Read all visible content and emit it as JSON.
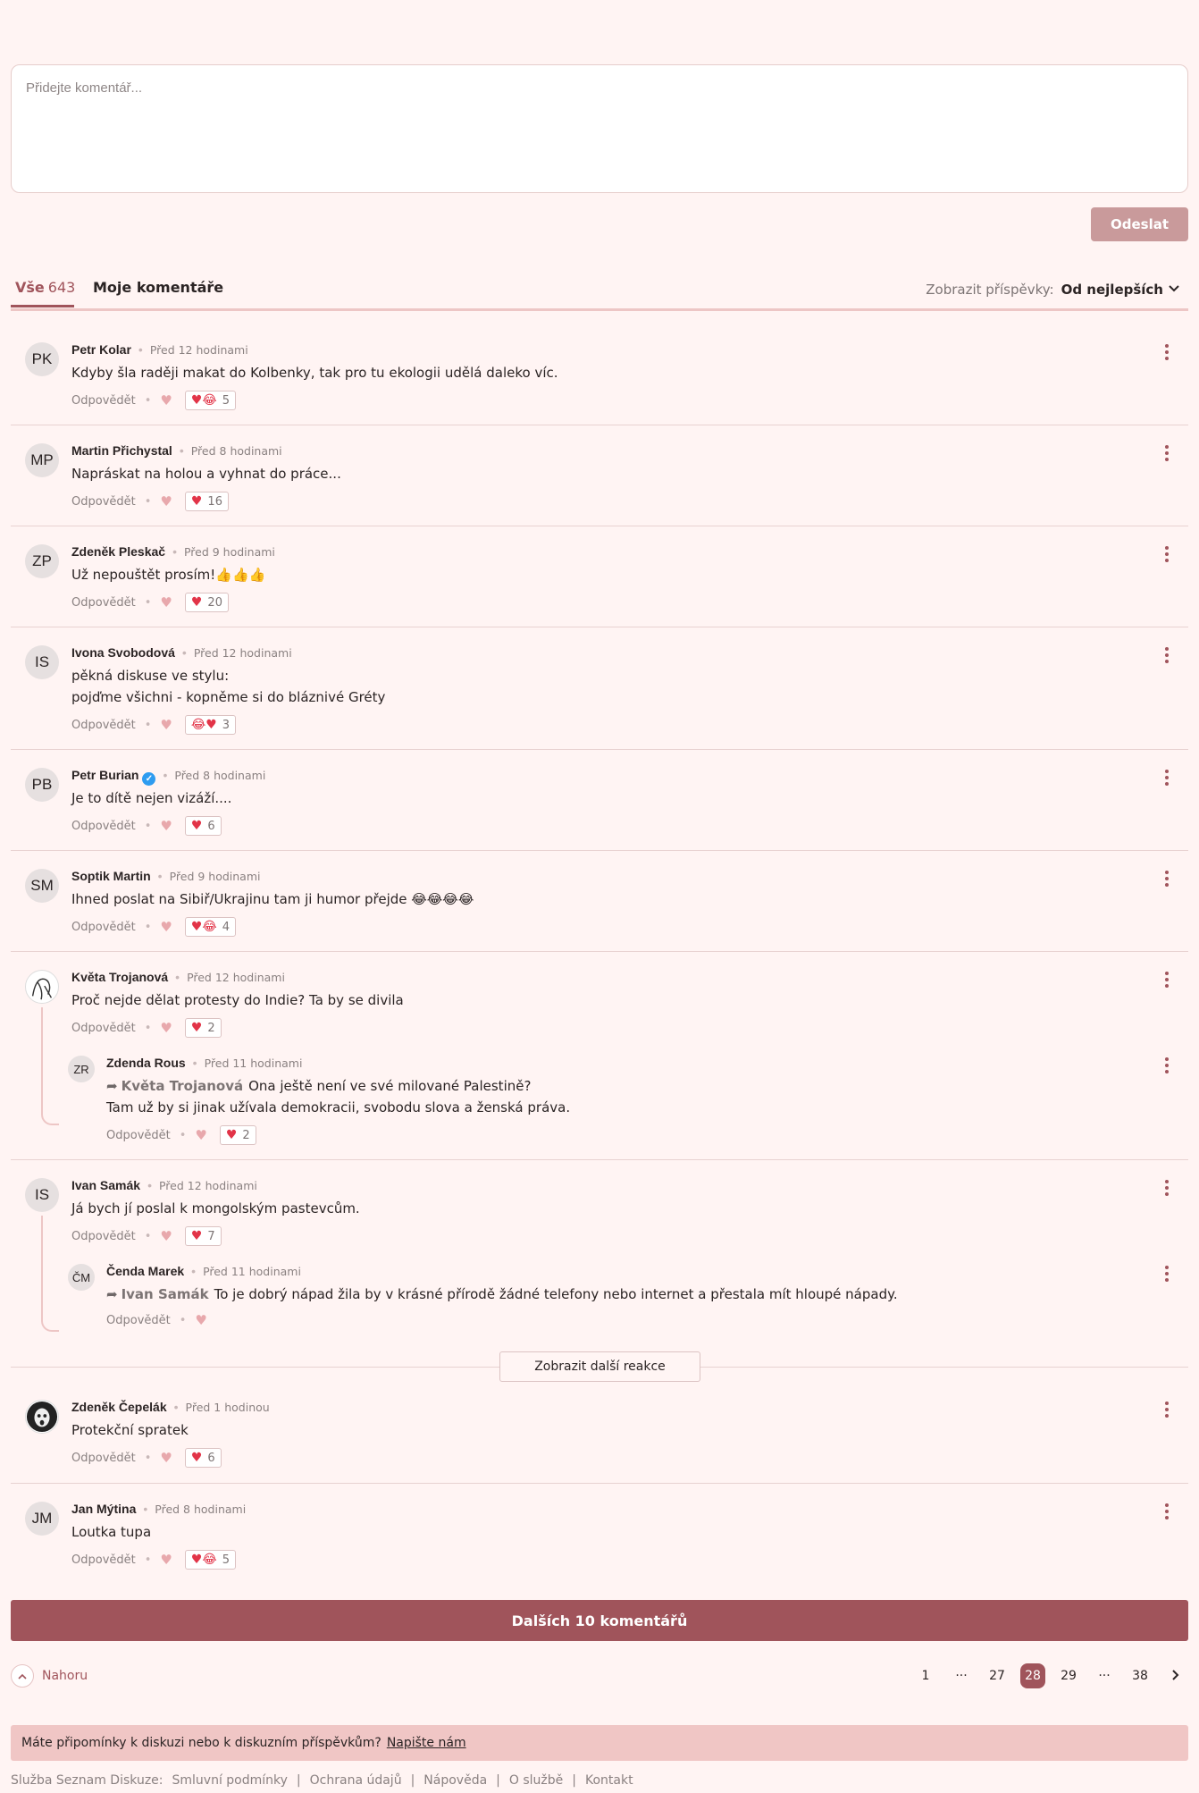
{
  "compose": {
    "placeholder": "Přidejte komentář...",
    "send_label": "Odeslat"
  },
  "tabs": {
    "all_label": "Vše",
    "all_count": "643",
    "mine_label": "Moje komentáře",
    "sort_label": "Zobrazit příspěvky:",
    "sort_value": "Od nejlepších"
  },
  "reply_label": "Odpovědět",
  "comments": [
    {
      "initials": "PK",
      "name": "Petr Kolar",
      "time": "Před 12 hodinami",
      "text": "Kdyby šla raději makat do Kolbenky, tak pro tu ekologii udělá daleko víc.",
      "reactions": "5",
      "reaction_icon": "heart-laugh-icon"
    },
    {
      "initials": "MP",
      "name": "Martin Přichystal",
      "time": "Před 8 hodinami",
      "text": "Napráskat na holou a vyhnat do práce...",
      "reactions": "16",
      "reaction_icon": "heart-icon"
    },
    {
      "initials": "ZP",
      "name": "Zdeněk Pleskač",
      "time": "Před 9 hodinami",
      "text": "Už nepouštět prosím!👍👍👍",
      "reactions": "20",
      "reaction_icon": "heart-icon"
    },
    {
      "initials": "IS",
      "name": "Ivona Svobodová",
      "time": "Před 12 hodinami",
      "text": "pěkná diskuse ve stylu:",
      "text2": "pojďme všichni - kopněme si do bláznivé Gréty",
      "reactions": "3",
      "reaction_icon": "laugh-heart-icon"
    },
    {
      "initials": "PB",
      "name": "Petr Burian",
      "time": "Před 8 hodinami",
      "text": "Je to dítě nejen vizáží....",
      "reactions": "6",
      "reaction_icon": "heart-icon",
      "verified": "✓"
    },
    {
      "initials": "SM",
      "name": "Soptik Martin",
      "time": "Před 9 hodinami",
      "text": "Ihned poslat na Sibiř/Ukrajinu tam ji humor přejde 😂😂😂😂",
      "reactions": "4",
      "reaction_icon": "heart-laugh-icon"
    },
    {
      "initials": "",
      "name": "Květa Trojanová",
      "time": "Před 12 hodinami",
      "text": "Proč nejde dělat protesty do Indie? Ta by se divila",
      "reactions": "2",
      "reaction_icon": "heart-icon"
    },
    {
      "initials": "IS",
      "name": "Ivan Samák",
      "time": "Před 12 hodinami",
      "text": "Já bych jí poslal k mongolským pastevcům.",
      "reactions": "7",
      "reaction_icon": "heart-icon"
    },
    {
      "initials": "",
      "name": "Zdeněk Čepelák",
      "time": "Před 1 hodinou",
      "text": "Protekční spratek",
      "reactions": "6",
      "reaction_icon": "heart-icon"
    },
    {
      "initials": "JM",
      "name": "Jan Mýtina",
      "time": "Před 8 hodinami",
      "text": "Loutka tupa",
      "reactions": "5",
      "reaction_icon": "heart-laugh-icon"
    }
  ],
  "replies": [
    {
      "initials": "ZR",
      "name": "Zdenda Rous",
      "time": "Před 11 hodinami",
      "reply_to": "Květa Trojanová",
      "text": "Ona ještě není ve své milované Palestině?",
      "text2": "Tam už by si jinak užívala demokracii, svobodu slova a ženská práva.",
      "reactions": "2"
    },
    {
      "initials": "ČM",
      "name": "Čenda Marek",
      "time": "Před 11 hodinami",
      "reply_to": "Ivan Samák",
      "text": "To je dobrý nápad žila by v krásné přírodě žádné telefony nebo internet a přestala mít hloupé nápady."
    }
  ],
  "more_reactions_label": "Zobrazit další reakce",
  "next_comments_label": "Dalších 10 komentářů",
  "top_link_label": "Nahoru",
  "pagination": [
    "1",
    "···",
    "27",
    "28",
    "29",
    "···",
    "38"
  ],
  "pagination_active": "28",
  "feedback": {
    "text": "Máte připomínky k diskuzi nebo k diskuzním příspěvkům?",
    "link": "Napište nám"
  },
  "footer": {
    "prefix": "Služba Seznam Diskuze:",
    "links": [
      "Smluvní podmínky",
      "Ochrana údajů",
      "Nápověda",
      "O službě",
      "Kontakt"
    ]
  },
  "colors": {
    "accent": "#a0545b",
    "background": "#fff4f3",
    "send_button": "#c99a9b",
    "feedback_bg": "#f0c6c5"
  }
}
